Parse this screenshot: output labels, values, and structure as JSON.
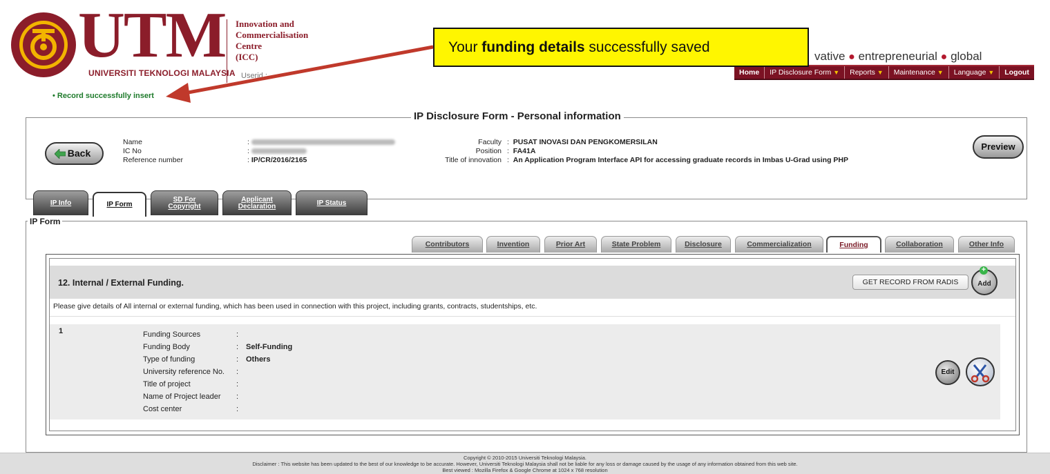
{
  "header": {
    "logo_word": "UTM",
    "logo_sub": "UNIVERSITI TEKNOLOGI MALAYSIA",
    "logo_ring_text": "KERANA TUHAN UNTUK MANUSIA • UNIVERSITI TEKNOLOGI MALAYSIA",
    "icc_line1": "Innovation and",
    "icc_line2": "Commercialisation",
    "icc_line3": "Centre",
    "icc_line4": "(ICC)",
    "userid_label": "Userid :",
    "tagline": [
      "vative",
      "entrepreneurial",
      "global"
    ]
  },
  "menu": {
    "home": "Home",
    "ip_disclosure": "IP Disclosure Form",
    "reports": "Reports",
    "maintenance": "Maintenance",
    "language": "Language",
    "logout": "Logout"
  },
  "callout": {
    "prefix": "Your ",
    "bold": "funding  details",
    "suffix": " successfully saved"
  },
  "record_message": "Record successfully insert",
  "personal_info": {
    "legend": "IP Disclosure Form - Personal information",
    "back_label": "Back",
    "preview_label": "Preview",
    "name_label": "Name",
    "ic_label": "IC No",
    "ref_label": "Reference number",
    "ref_value": "IP/CR/2016/2165",
    "faculty_label": "Faculty",
    "faculty_value": "PUSAT INOVASI DAN PENGKOMERSILAN",
    "position_label": "Position",
    "position_value": "FA41A",
    "title_label": "Title of innovation",
    "title_value": "An Application Program Interface API for accessing graduate records in Imbas U-Grad using PHP"
  },
  "main_tabs": {
    "ip_info": "IP Info",
    "ip_form": "IP Form",
    "sd_line1": "SD For",
    "sd_line2": "Copyright",
    "applicant_line1": "Applicant",
    "applicant_line2": "Declaration",
    "ip_status": "IP Status"
  },
  "ip_form_legend": "IP Form",
  "sub_tabs": {
    "contributors": "Contributors",
    "invention": "Invention",
    "prior_art": "Prior Art",
    "state_problem": "State Problem",
    "disclosure": "Disclosure",
    "commercialization": "Commercialization",
    "funding": "Funding",
    "collaboration": "Collaboration",
    "other_info": "Other Info"
  },
  "funding": {
    "title": "12. Internal / External Funding.",
    "radis_button": "GET RECORD FROM RADIS",
    "add_button": "Add",
    "description": "Please give details of All internal or external funding, which has been used in connection with this project, including grants, contracts, studentships, etc.",
    "record_number": "1",
    "labels": {
      "sources": "Funding Sources",
      "body": "Funding Body",
      "type": "Type of funding",
      "university_ref": "University reference No.",
      "project_title": "Title of project",
      "project_leader": "Name of Project leader",
      "cost_center": "Cost center"
    },
    "values": {
      "body": "Self-Funding",
      "type": "Others"
    },
    "edit_button": "Edit"
  },
  "footer": {
    "copyright": "Copyright © 2010-2015 Universiti Teknologi Malaysia.",
    "disclaimer": "Disclaimer : This website has been updated to the best of our knowledge to be accurate. However, Universiti Teknologi Malaysia shall not be liable for any loss or damage caused by the usage of any information obtained from this web site.",
    "best_viewed": "Best viewed : Mozilla Firefox & Google Chrome at 1024 x 768 resolution"
  },
  "colors": {
    "brand_maroon": "#8b1d2a",
    "menu_bg": "#7b1223",
    "callout_yellow": "#fff600",
    "arrow_red": "#c0392b",
    "success_green": "#1d7a2a"
  }
}
